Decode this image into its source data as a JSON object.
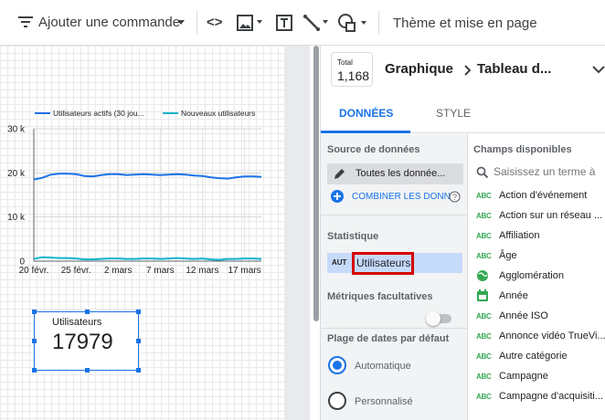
{
  "toolbar": {
    "add_command": "Ajouter une commande",
    "theme_label": "Thème et mise en page"
  },
  "chart_data": {
    "type": "line",
    "x": [
      "20 févr.",
      "21 févr.",
      "22 févr.",
      "23 févr.",
      "24 févr.",
      "25 févr.",
      "26 févr.",
      "27 févr.",
      "28 févr.",
      "1 mars",
      "2 mars",
      "3 mars",
      "4 mars",
      "5 mars",
      "6 mars",
      "7 mars",
      "8 mars",
      "9 mars",
      "10 mars",
      "11 mars",
      "12 mars",
      "13 mars",
      "14 mars",
      "15 mars",
      "16 mars",
      "17 mars",
      "18 mars",
      "19 mars"
    ],
    "x_tick_labels": [
      "20 févr.",
      "25 févr.",
      "2 mars",
      "7 mars",
      "12 mars",
      "17 mars"
    ],
    "series": [
      {
        "name": "Utilisateurs actifs (30 jou...",
        "color": "#1a73e8",
        "values": [
          18500,
          18900,
          19600,
          19800,
          19800,
          19700,
          19300,
          19200,
          19500,
          19700,
          19700,
          19500,
          19600,
          19700,
          19600,
          19500,
          19600,
          19700,
          19600,
          19400,
          19300,
          19000,
          18800,
          18700,
          19000,
          19200,
          19200,
          19100
        ]
      },
      {
        "name": "Nouveaux utilisateurs",
        "color": "#12b5cb",
        "values": [
          500,
          900,
          800,
          700,
          700,
          600,
          400,
          400,
          500,
          600,
          600,
          500,
          500,
          600,
          600,
          500,
          600,
          700,
          600,
          500,
          600,
          400,
          300,
          500,
          500,
          600,
          600,
          500
        ]
      }
    ],
    "y_ticks": [
      "0",
      "10 k",
      "20 k",
      "30 k"
    ],
    "ylim": [
      0,
      30000
    ],
    "grid": true,
    "legend": "top"
  },
  "scorecard": {
    "label": "Utilisateurs",
    "value": "17979"
  },
  "panel": {
    "total_label": "Total",
    "total_value": "1,168",
    "breadcrumb_1": "Graphique",
    "breadcrumb_2": "Tableau d...",
    "tab_data": "DONNÉES",
    "tab_style": "STYLE",
    "source_title": "Source de données",
    "source_name": "Toutes les donnée...",
    "combine": "COMBINER LES DONN",
    "stat_title": "Statistique",
    "stat_type": "AUT",
    "stat_name": "Utilisateurs",
    "optional_metrics": "Métriques facultatives",
    "date_range_title": "Plage de dates par défaut",
    "auto_label": "Automatique",
    "custom_label": "Personnalisé",
    "fields_title": "Champs disponibles",
    "search_placeholder": "Saisissez un terme à",
    "fields": [
      {
        "type": "abc",
        "name": "Action d'événement"
      },
      {
        "type": "abc",
        "name": "Action sur un réseau ..."
      },
      {
        "type": "abc",
        "name": "Affiliation"
      },
      {
        "type": "abc",
        "name": "Âge"
      },
      {
        "type": "geo",
        "name": "Agglomération"
      },
      {
        "type": "date",
        "name": "Année"
      },
      {
        "type": "abc",
        "name": "Année ISO"
      },
      {
        "type": "abc",
        "name": "Annonce vidéo TrueVi..."
      },
      {
        "type": "abc",
        "name": "Autre catégorie"
      },
      {
        "type": "abc",
        "name": "Campagne"
      },
      {
        "type": "abc",
        "name": "Campagne d'acquisiti..."
      }
    ],
    "colors": {
      "accent": "#1a73e8",
      "highlight": "#d50000"
    }
  }
}
